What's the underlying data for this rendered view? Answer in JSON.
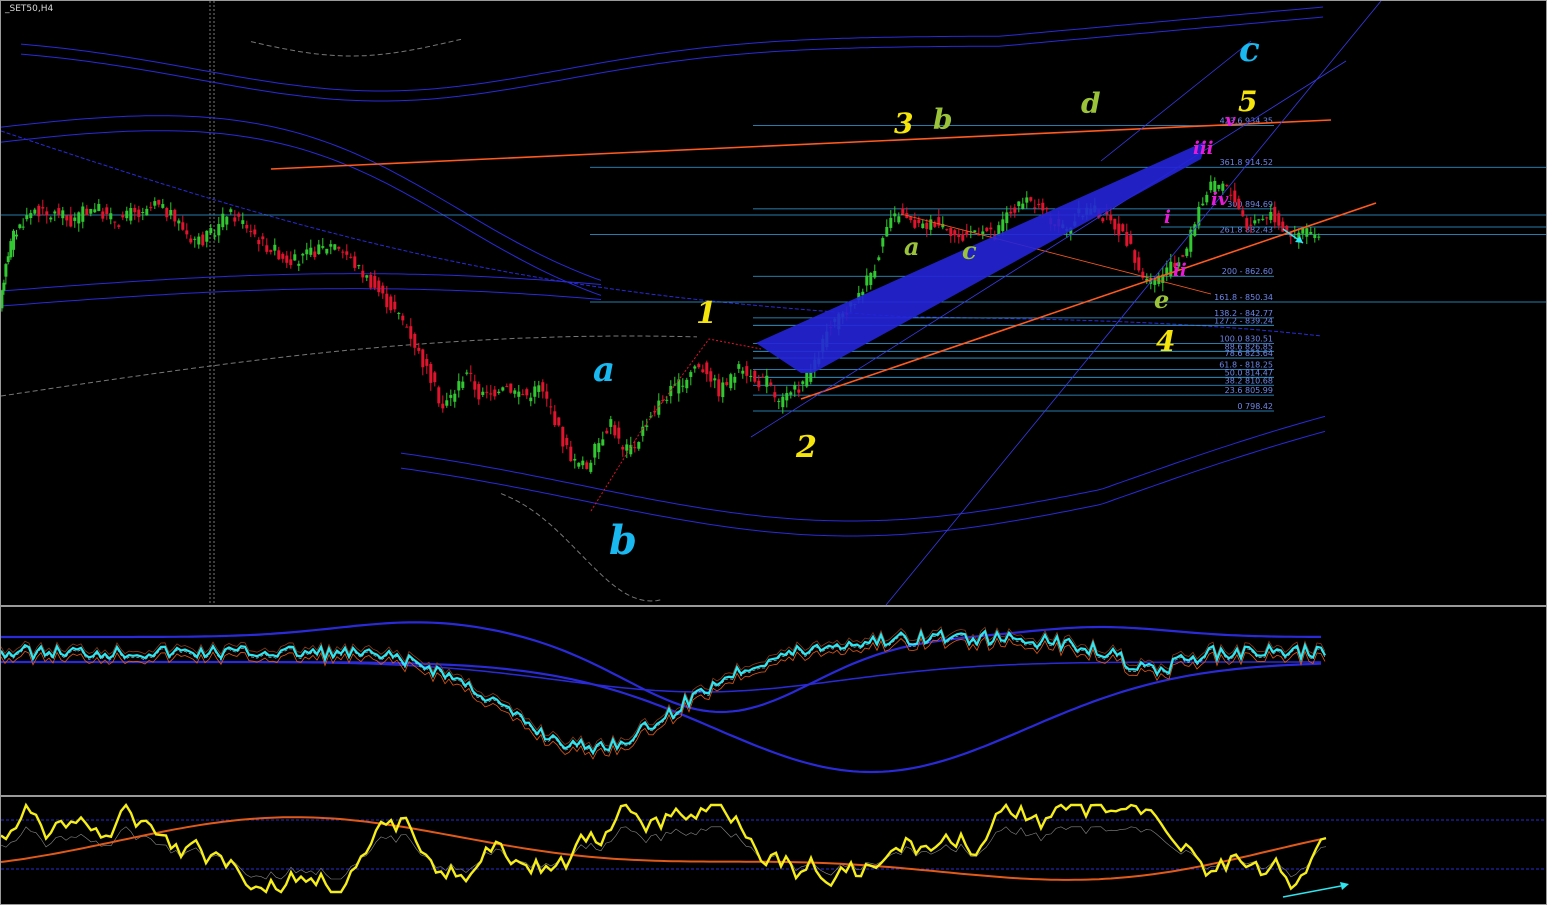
{
  "window": {
    "symbol_label": "_SET50,H4"
  },
  "chart_data": [
    {
      "type": "candlestick",
      "title": "_SET50,H4",
      "fib_levels": [
        {
          "label": "423.6 934.35",
          "ratio": 423.6,
          "price": 934.35
        },
        {
          "label": "361.8 914.52",
          "ratio": 361.8,
          "price": 914.52
        },
        {
          "label": "300 894.69",
          "ratio": 300,
          "price": 894.69
        },
        {
          "label": "261.8 882.43",
          "ratio": 261.8,
          "price": 882.43
        },
        {
          "label": "200 - 862.60",
          "ratio": 200,
          "price": 862.6
        },
        {
          "label": "161.8 - 850.34",
          "ratio": 161.8,
          "price": 850.34
        },
        {
          "label": "138.2 - 842.77",
          "ratio": 138.2,
          "price": 842.77
        },
        {
          "label": "127.2 - 839.24",
          "ratio": 127.2,
          "price": 839.24
        },
        {
          "label": "100.0 830.51",
          "ratio": 100.0,
          "price": 830.51
        },
        {
          "label": "88.6 826.85",
          "ratio": 88.6,
          "price": 826.85
        },
        {
          "label": "78.6 823.64",
          "ratio": 78.6,
          "price": 823.64
        },
        {
          "label": "61.8 - 818.25",
          "ratio": 61.8,
          "price": 818.25
        },
        {
          "label": "50.0 814.47",
          "ratio": 50.0,
          "price": 814.47
        },
        {
          "label": "38.2 810.68",
          "ratio": 38.2,
          "price": 810.68
        },
        {
          "label": "23.6 805.99",
          "ratio": 23.6,
          "price": 805.99
        },
        {
          "label": "0 798.42",
          "ratio": 0,
          "price": 798.42
        }
      ],
      "wave_labels": [
        {
          "text": "a",
          "color": "#19b8f0",
          "role": "primary"
        },
        {
          "text": "b",
          "color": "#19b8f0",
          "role": "primary"
        },
        {
          "text": "c",
          "color": "#19b8f0",
          "role": "primary"
        },
        {
          "text": "1",
          "color": "#f5e50a",
          "role": "impulse"
        },
        {
          "text": "2",
          "color": "#f5e50a",
          "role": "impulse"
        },
        {
          "text": "3",
          "color": "#f5e50a",
          "role": "impulse"
        },
        {
          "text": "4",
          "color": "#f5e50a",
          "role": "impulse"
        },
        {
          "text": "5",
          "color": "#f5e50a",
          "role": "impulse"
        },
        {
          "text": "a",
          "color": "#9ac33a",
          "role": "triangle"
        },
        {
          "text": "b",
          "color": "#9ac33a",
          "role": "triangle"
        },
        {
          "text": "c",
          "color": "#9ac33a",
          "role": "triangle"
        },
        {
          "text": "d",
          "color": "#9ac33a",
          "role": "triangle"
        },
        {
          "text": "e",
          "color": "#9ac33a",
          "role": "triangle"
        },
        {
          "text": "i",
          "color": "#e81ad8",
          "role": "minor"
        },
        {
          "text": "ii",
          "color": "#e81ad8",
          "role": "minor"
        },
        {
          "text": "iii",
          "color": "#e81ad8",
          "role": "minor"
        },
        {
          "text": "iv",
          "color": "#e81ad8",
          "role": "minor"
        },
        {
          "text": "v",
          "color": "#e81ad8",
          "role": "minor"
        }
      ],
      "price_path": [
        [
          0,
          845
        ],
        [
          6,
          870
        ],
        [
          14,
          882
        ],
        [
          24,
          889
        ],
        [
          36,
          895
        ],
        [
          48,
          891
        ],
        [
          60,
          893
        ],
        [
          72,
          888
        ],
        [
          84,
          893
        ],
        [
          96,
          896
        ],
        [
          108,
          891
        ],
        [
          120,
          889
        ],
        [
          132,
          893
        ],
        [
          144,
          891
        ],
        [
          156,
          897
        ],
        [
          168,
          893
        ],
        [
          180,
          888
        ],
        [
          192,
          881
        ],
        [
          204,
          880
        ],
        [
          216,
          884
        ],
        [
          228,
          893
        ],
        [
          240,
          890
        ],
        [
          252,
          885
        ],
        [
          264,
          878
        ],
        [
          276,
          875
        ],
        [
          288,
          871
        ],
        [
          300,
          870
        ],
        [
          312,
          874
        ],
        [
          324,
          876
        ],
        [
          336,
          879
        ],
        [
          348,
          873
        ],
        [
          360,
          866
        ],
        [
          372,
          860
        ],
        [
          384,
          853
        ],
        [
          396,
          846
        ],
        [
          408,
          839
        ],
        [
          420,
          826
        ],
        [
          432,
          814
        ],
        [
          444,
          800
        ],
        [
          456,
          808
        ],
        [
          468,
          818
        ],
        [
          480,
          806
        ],
        [
          492,
          806
        ],
        [
          504,
          812
        ],
        [
          516,
          808
        ],
        [
          528,
          806
        ],
        [
          540,
          810
        ],
        [
          552,
          800
        ],
        [
          564,
          784
        ],
        [
          576,
          774
        ],
        [
          588,
          772
        ],
        [
          600,
          784
        ],
        [
          612,
          794
        ],
        [
          624,
          779
        ],
        [
          636,
          782
        ],
        [
          648,
          794
        ],
        [
          660,
          802
        ],
        [
          672,
          808
        ],
        [
          684,
          812
        ],
        [
          696,
          820
        ],
        [
          708,
          818
        ],
        [
          720,
          808
        ],
        [
          732,
          814
        ],
        [
          744,
          820
        ],
        [
          756,
          812
        ],
        [
          768,
          813
        ],
        [
          780,
          802
        ],
        [
          792,
          806
        ],
        [
          804,
          812
        ],
        [
          816,
          820
        ],
        [
          828,
          836
        ],
        [
          840,
          842
        ],
        [
          852,
          848
        ],
        [
          864,
          858
        ],
        [
          876,
          868
        ],
        [
          888,
          886
        ],
        [
          900,
          893
        ],
        [
          912,
          888
        ],
        [
          924,
          886
        ],
        [
          936,
          889
        ],
        [
          948,
          887
        ],
        [
          960,
          880
        ],
        [
          972,
          884
        ],
        [
          984,
          886
        ],
        [
          996,
          881
        ],
        [
          1008,
          892
        ],
        [
          1020,
          896
        ],
        [
          1032,
          898
        ],
        [
          1044,
          894
        ],
        [
          1056,
          888
        ],
        [
          1068,
          885
        ],
        [
          1080,
          892
        ],
        [
          1092,
          896
        ],
        [
          1104,
          891
        ],
        [
          1116,
          887
        ],
        [
          1128,
          880
        ],
        [
          1140,
          866
        ],
        [
          1152,
          858
        ],
        [
          1164,
          864
        ],
        [
          1176,
          868
        ],
        [
          1188,
          876
        ],
        [
          1200,
          896
        ],
        [
          1212,
          905
        ],
        [
          1224,
          906
        ],
        [
          1236,
          900
        ],
        [
          1248,
          887
        ],
        [
          1260,
          890
        ],
        [
          1272,
          893
        ],
        [
          1284,
          886
        ],
        [
          1296,
          882
        ],
        [
          1308,
          885
        ],
        [
          1320,
          880
        ]
      ]
    },
    {
      "type": "line",
      "series": [
        {
          "color": "#2ee6f0",
          "role": "main-oscillator"
        },
        {
          "color": "#1a1ad8",
          "role": "envelope-bands"
        },
        {
          "color": "#e05a1a",
          "role": "moving-averages"
        }
      ]
    },
    {
      "type": "line",
      "series": [
        {
          "color": "#f5ee1a",
          "role": "oscillator"
        },
        {
          "color": "#e05a1a",
          "role": "signal"
        }
      ]
    }
  ],
  "colors": {
    "background": "#000000",
    "bull_candle": "#32c832",
    "bear_candle": "#e0142d",
    "fib_line": "#36a5e0",
    "trendline": "#ff5a1f",
    "channel": "#2a2ad8",
    "arrow": "#2ee6f0"
  }
}
